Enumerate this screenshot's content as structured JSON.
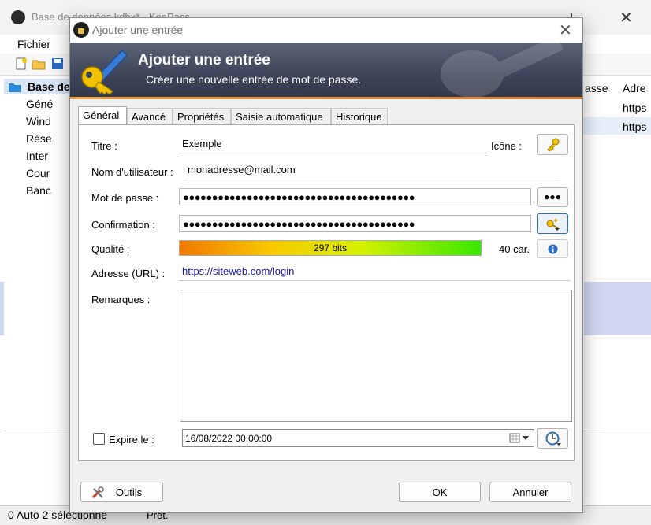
{
  "background": {
    "title": "Base de données.kdbx* - KeePass",
    "menu_file": "Fichier",
    "tree_root": "Base de",
    "tree_items": [
      "Géné",
      "Wind",
      "Rése",
      "Inter",
      "Cour",
      "Banc"
    ],
    "column_headers": [
      "asse",
      "Adre"
    ],
    "cells": [
      "https",
      "https"
    ],
    "status_left": "0 Auto 2 sélectionné",
    "status_right": "Prêt."
  },
  "dialog": {
    "title": "Ajouter une entrée",
    "banner_title": "Ajouter une entrée",
    "banner_subtitle": "Créer une nouvelle entrée de mot de passe.",
    "tabs": [
      "Général",
      "Avancé",
      "Propriétés",
      "Saisie automatique",
      "Historique"
    ],
    "active_tab": "Général",
    "labels": {
      "title": "Titre :",
      "icon": "Icône :",
      "username": "Nom d'utilisateur :",
      "password": "Mot de passe :",
      "confirm": "Confirmation :",
      "quality": "Qualité :",
      "url": "Adresse (URL) :",
      "notes": "Remarques :",
      "expires": "Expire le :"
    },
    "values": {
      "title": "Exemple",
      "username": "monadresse@mail.com",
      "password": "●●●●●●●●●●●●●●●●●●●●●●●●●●●●●●●●●●●●●●●●",
      "confirm": "●●●●●●●●●●●●●●●●●●●●●●●●●●●●●●●●●●●●●●●●",
      "quality_bits": "297 bits",
      "quality_fraction": 1.0,
      "char_count": "40 car.",
      "url": "https://siteweb.com/login",
      "notes": "",
      "expiry": "16/08/2022 00:00:00",
      "expires_checked": false
    },
    "buttons": {
      "show_password": "●●●",
      "tools": "Outils",
      "ok": "OK",
      "cancel": "Annuler"
    },
    "colors": {
      "banner_dark": "#3d4457",
      "banner_accent": "#e07a2e",
      "url_text": "#1a1aa6"
    }
  }
}
